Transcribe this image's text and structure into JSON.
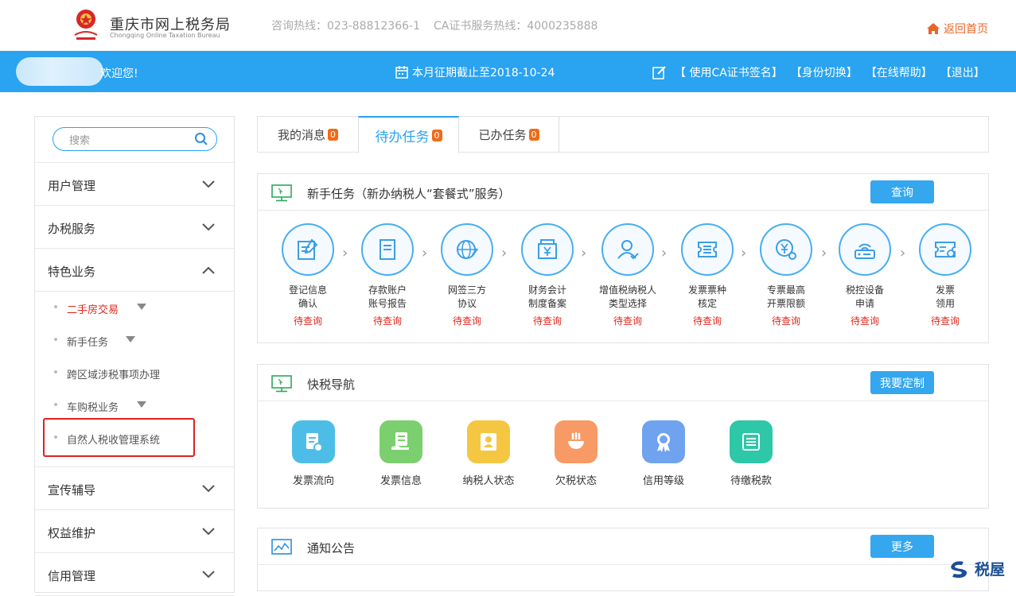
{
  "header": {
    "site_title": "重庆市网上税务局",
    "site_subtitle": "Chongqing Online Taxation Bureau",
    "hotline": "咨询热线：023-88812366-1",
    "ca_hotline": "CA证书服务热线：4000235888",
    "home_link": "返回首页"
  },
  "bar": {
    "welcome": "欢迎您!",
    "deadline": "本月征期截止至2018-10-24",
    "actions": [
      "【 使用CA证书签名】",
      "【身份切换】",
      "【在线帮助】",
      "【退出】"
    ]
  },
  "sidebar": {
    "search_placeholder": "搜索",
    "menus": [
      {
        "label": "用户管理"
      },
      {
        "label": "办税服务"
      },
      {
        "label": "特色业务"
      }
    ],
    "subitems": [
      {
        "label": "二手房交易",
        "color": "#e0281c"
      },
      {
        "label": "新手任务"
      },
      {
        "label": "跨区域涉税事项办理"
      },
      {
        "label": "车购税业务"
      },
      {
        "label": "自然人税收管理系统"
      }
    ],
    "menus_bottom": [
      {
        "label": "宣传辅导"
      },
      {
        "label": "权益维护"
      },
      {
        "label": "信用管理"
      }
    ]
  },
  "tabs": [
    {
      "label": "我的消息",
      "badge": "0"
    },
    {
      "label": "待办任务",
      "badge": "0"
    },
    {
      "label": "已办任务",
      "badge": "0"
    }
  ],
  "newbie": {
    "title": "新手任务（新办纳税人“套餐式”服务）",
    "button": "查询",
    "steps": [
      {
        "line1": "登记信息",
        "line2": "确认",
        "status": "待查询"
      },
      {
        "line1": "存款账户",
        "line2": "账号报告",
        "status": "待查询"
      },
      {
        "line1": "网签三方",
        "line2": "协议",
        "status": "待查询"
      },
      {
        "line1": "财务会计",
        "line2": "制度备案",
        "status": "待查询"
      },
      {
        "line1": "增值税纳税人",
        "line2": "类型选择",
        "status": "待查询"
      },
      {
        "line1": "发票票种",
        "line2": "核定",
        "status": "待查询"
      },
      {
        "line1": "专票最高",
        "line2": "开票限额",
        "status": "待查询"
      },
      {
        "line1": "税控设备",
        "line2": "申请",
        "status": "待查询"
      },
      {
        "line1": "发票",
        "line2": "领用",
        "status": "待查询"
      }
    ]
  },
  "quicknav": {
    "title": "快税导航",
    "button": "我要定制",
    "items": [
      {
        "label": "发票流向",
        "color": "#4dbde8"
      },
      {
        "label": "发票信息",
        "color": "#7ccf6e"
      },
      {
        "label": "纳税人状态",
        "color": "#f5c642"
      },
      {
        "label": "欠税状态",
        "color": "#f79a65"
      },
      {
        "label": "信用等级",
        "color": "#6fa3ef"
      },
      {
        "label": "待缴税款",
        "color": "#2ec7a7"
      }
    ]
  },
  "notice": {
    "title": "通知公告",
    "button": "更多"
  },
  "watermark": "税屋"
}
